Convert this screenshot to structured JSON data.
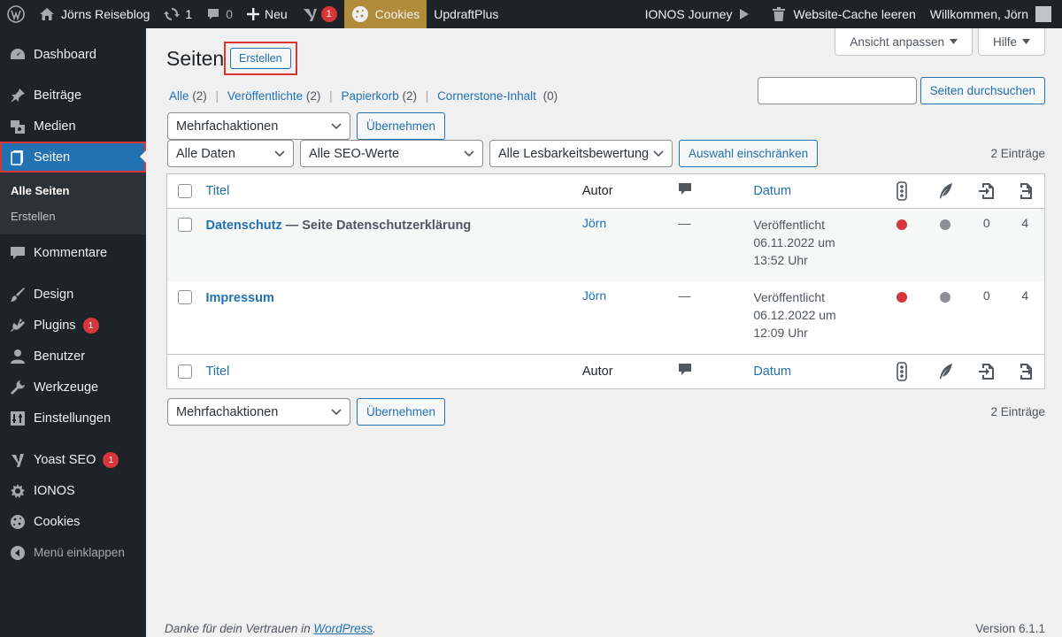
{
  "adminbar": {
    "site_name": "Jörns Reiseblog",
    "updates_count": "1",
    "comments_count": "0",
    "new_label": "Neu",
    "yoast_badge": "1",
    "cookies_label": "Cookies",
    "updraft_label": "UpdraftPlus",
    "ionos_journey": "IONOS Journey",
    "cache_label": "Website-Cache leeren",
    "welcome": "Willkommen, Jörn"
  },
  "sidebar": {
    "items": [
      {
        "label": "Dashboard",
        "icon": "dashboard-icon"
      },
      {
        "label": "Beiträge",
        "icon": "pin-icon"
      },
      {
        "label": "Medien",
        "icon": "media-icon"
      },
      {
        "label": "Seiten",
        "icon": "pages-icon"
      },
      {
        "label": "Kommentare",
        "icon": "comment-icon"
      },
      {
        "label": "Design",
        "icon": "brush-icon"
      },
      {
        "label": "Plugins",
        "icon": "plugin-icon",
        "badge": "1"
      },
      {
        "label": "Benutzer",
        "icon": "user-icon"
      },
      {
        "label": "Werkzeuge",
        "icon": "wrench-icon"
      },
      {
        "label": "Einstellungen",
        "icon": "settings-icon"
      },
      {
        "label": "Yoast SEO",
        "icon": "yoast-icon",
        "badge": "1"
      },
      {
        "label": "IONOS",
        "icon": "ionos-icon"
      },
      {
        "label": "Cookies",
        "icon": "cookie-icon"
      }
    ],
    "submenu": {
      "all_pages": "Alle Seiten",
      "create": "Erstellen"
    },
    "collapse": "Menü einklappen"
  },
  "screen_meta": {
    "options": "Ansicht anpassen",
    "help": "Hilfe"
  },
  "page": {
    "title": "Seiten",
    "add_new": "Erstellen"
  },
  "views": {
    "all": "Alle",
    "all_count": "(2)",
    "published": "Veröffentlichte",
    "published_count": "(2)",
    "trash": "Papierkorb",
    "trash_count": "(2)",
    "cornerstone": "Cornerstone-Inhalt",
    "cornerstone_count": "(0)",
    "sep": "|"
  },
  "search": {
    "button": "Seiten durchsuchen",
    "value": ""
  },
  "bulk": {
    "select": "Mehrfachaktionen",
    "apply": "Übernehmen"
  },
  "filters": {
    "dates": "Alle Daten",
    "seo": "Alle SEO-Werte",
    "readability": "Alle Lesbarkeitsbewertung",
    "filter_button": "Auswahl einschränken"
  },
  "items_count": "2 Einträge",
  "table": {
    "headers": {
      "title": "Titel",
      "author": "Autor",
      "date": "Datum"
    },
    "rows": [
      {
        "title": "Datenschutz",
        "suffix": " — Seite Datenschutzerklärung",
        "author": "Jörn",
        "comments": "—",
        "status": "Veröffentlicht",
        "date": "06.11.2022 um",
        "time": "13:52 Uhr",
        "seo_color": "#d63638",
        "read_color": "#8c8f94",
        "links": "0",
        "inlinks": "4"
      },
      {
        "title": "Impressum",
        "suffix": "",
        "author": "Jörn",
        "comments": "—",
        "status": "Veröffentlicht",
        "date": "06.12.2022 um",
        "time": "12:09 Uhr",
        "seo_color": "#d63638",
        "read_color": "#8c8f94",
        "links": "0",
        "inlinks": "4"
      }
    ]
  },
  "footer": {
    "thanks": "Danke für dein Vertrauen in ",
    "wp_link": "WordPress",
    "dot": ".",
    "version": "Version 6.1.1"
  }
}
